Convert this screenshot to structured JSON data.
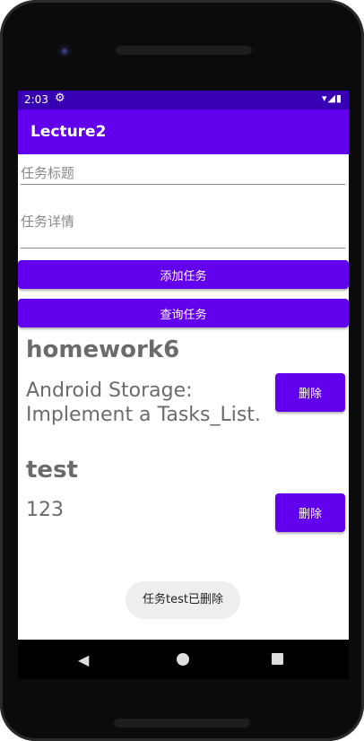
{
  "status_bar": {
    "time": "2:03",
    "gear_icon": "⚙",
    "right_icons": "▾◢▮"
  },
  "app_bar": {
    "title": "Lecture2"
  },
  "form": {
    "title_placeholder": "任务标题",
    "detail_placeholder": "任务详情",
    "add_button": "添加任务",
    "query_button": "查询任务"
  },
  "tasks": [
    {
      "title": "homework6",
      "description": "Android Storage: Implement a Tasks_List.",
      "delete_label": "删除"
    },
    {
      "title": "test",
      "description": "123",
      "delete_label": "删除"
    }
  ],
  "toast": {
    "message": "任务test已删除"
  },
  "nav": {
    "back_icon": "◀"
  },
  "colors": {
    "primary": "#6200ee",
    "primary_dark": "#3700b3",
    "text_gray": "#6b6b6b"
  }
}
